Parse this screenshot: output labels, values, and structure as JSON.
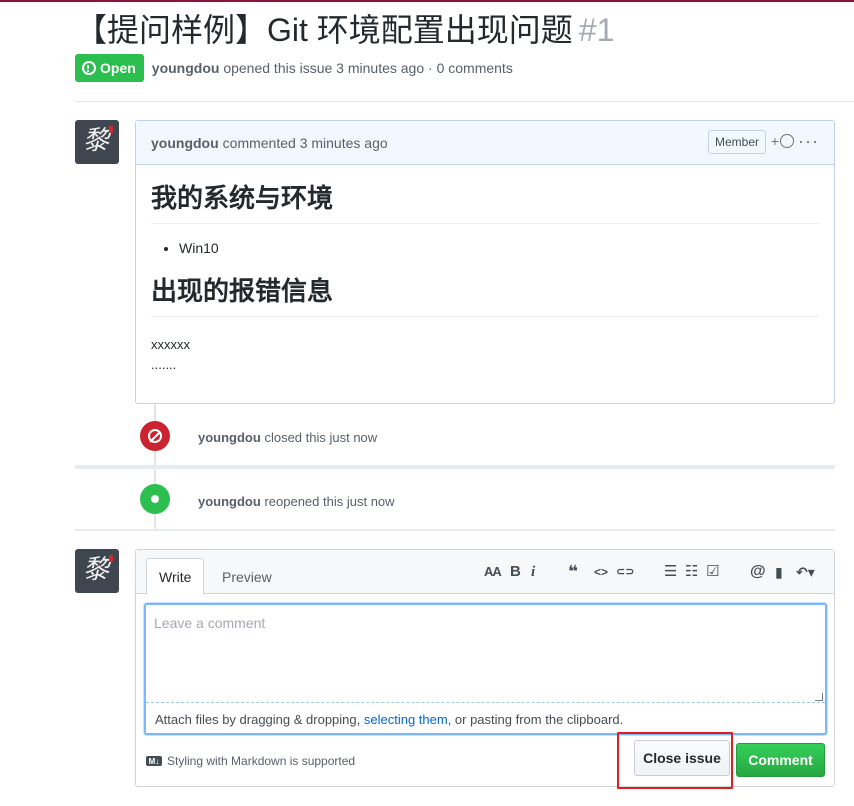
{
  "issue": {
    "title": "【提问样例】Git 环境配置出现问题",
    "number": "#1",
    "state_label": "Open",
    "author": "youngdou",
    "opened_text": "opened this issue 3 minutes ago · 0 comments"
  },
  "comment": {
    "author": "youngdou",
    "time_text": "commented 3 minutes ago",
    "role_badge": "Member",
    "reaction_plus": "+",
    "more": "···",
    "heading1": "我的系统与环境",
    "list_items": [
      "Win10"
    ],
    "heading2": "出现的报错信息",
    "body_lines": [
      "xxxxxx",
      "......."
    ]
  },
  "events": [
    {
      "author": "youngdou",
      "text": "closed this just now",
      "type": "closed"
    },
    {
      "author": "youngdou",
      "text": "reopened this just now",
      "type": "reopened"
    }
  ],
  "avatar": {
    "glyph": "黎"
  },
  "editor": {
    "tab_write": "Write",
    "tab_preview": "Preview",
    "toolbar": {
      "header": "AA",
      "bold": "B",
      "italic": "i",
      "quote": "❝",
      "code": "<>",
      "link": "⊂⊃",
      "bullet_list": "☰",
      "numbered_list": "☷",
      "task_list": "☑",
      "mention": "@",
      "bookmark": "▮",
      "reply": "↶▾"
    },
    "placeholder": "Leave a comment",
    "attach_prefix": "Attach files by dragging & dropping, ",
    "attach_link": "selecting them",
    "attach_suffix": ", or pasting from the clipboard.",
    "markdown_icon": "M↓",
    "markdown_note": "Styling with Markdown is supported",
    "close_button": "Close issue",
    "comment_button": "Comment"
  },
  "colors": {
    "open_green": "#2cbe4e",
    "closed_red": "#cb2431",
    "link_blue": "#0366d6",
    "highlight_red": "#e01e1e"
  }
}
